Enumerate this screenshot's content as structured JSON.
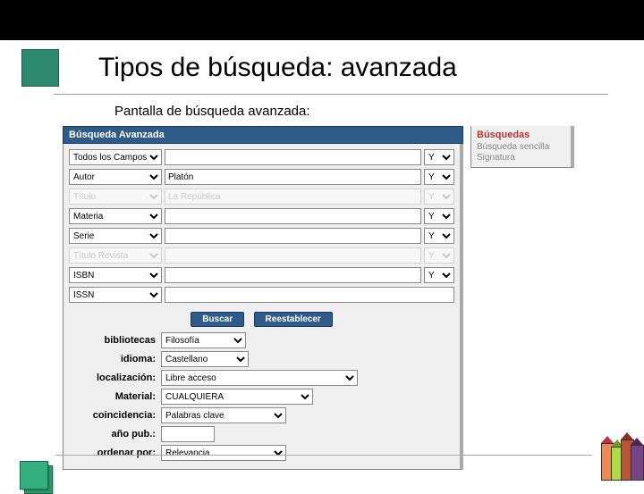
{
  "title": "Tipos de búsqueda: avanzada",
  "subtitle": "Pantalla de búsqueda avanzada:",
  "panel_header": "Búsqueda Avanzada",
  "search_rows": [
    {
      "field": "Todos los Campos",
      "value": "",
      "bool": "Y",
      "gray": false
    },
    {
      "field": "Autor",
      "value": "Platón",
      "bool": "Y",
      "gray": false
    },
    {
      "field": "Título",
      "value": "La República",
      "bool": "Y",
      "gray": true
    },
    {
      "field": "Materia",
      "value": "",
      "bool": "Y",
      "gray": false
    },
    {
      "field": "Serie",
      "value": "",
      "bool": "Y",
      "gray": false
    },
    {
      "field": "Título Revista",
      "value": "",
      "bool": "Y",
      "gray": true
    },
    {
      "field": "ISBN",
      "value": "",
      "bool": "Y",
      "gray": false
    },
    {
      "field": "ISSN",
      "value": "",
      "bool": "",
      "gray": false
    }
  ],
  "buttons": {
    "search": "Buscar",
    "reset": "Reestablecer"
  },
  "filters": {
    "bibliotecas": {
      "label": "bibliotecas",
      "value": "Filosofía"
    },
    "idioma": {
      "label": "idioma:",
      "value": "Castellano"
    },
    "localizacion": {
      "label": "localización:",
      "value": "Libre acceso"
    },
    "material": {
      "label": "Material:",
      "value": "CUALQUIERA"
    },
    "coincidencia": {
      "label": "coincidencia:",
      "value": "Palabras clave"
    },
    "ano_pub": {
      "label": "año pub.:",
      "value": ""
    },
    "ordenar": {
      "label": "ordenar por:",
      "value": "Relevancia"
    }
  },
  "side": {
    "title": "Búsquedas",
    "links": [
      "Búsqueda sencilla",
      "Signatura"
    ]
  }
}
